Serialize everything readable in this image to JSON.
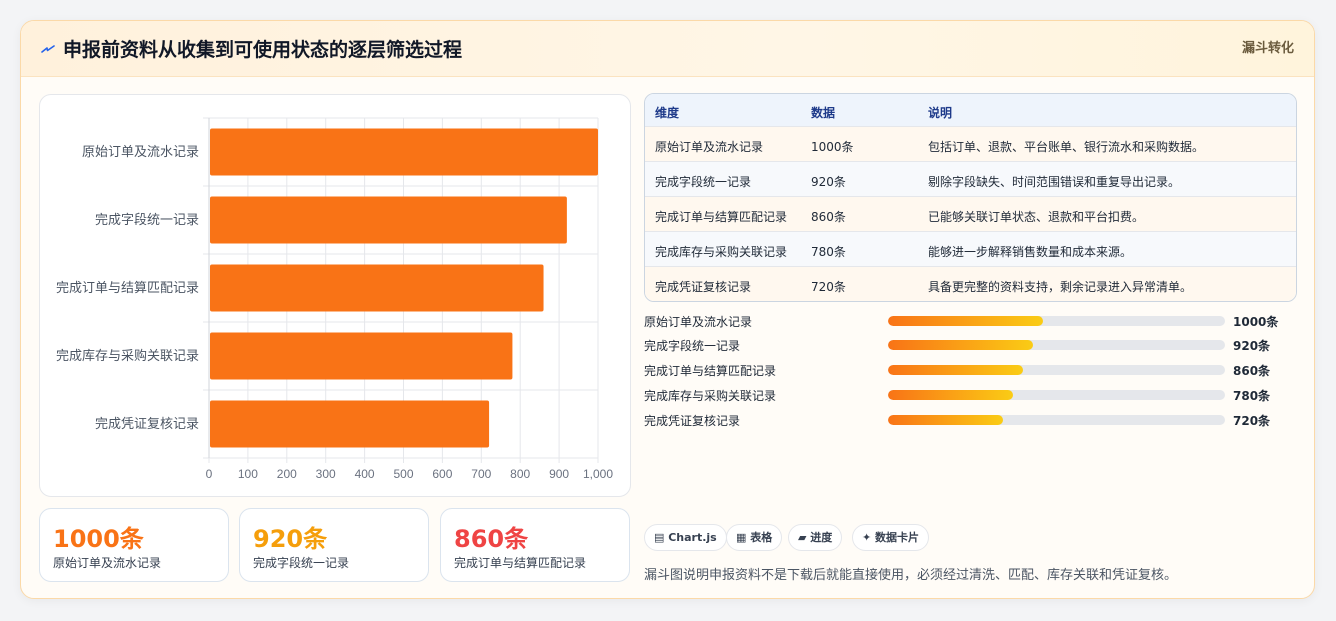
{
  "header": {
    "title": "申报前资料从收集到可使用状态的逐层筛选过程",
    "tag": "漏斗转化",
    "icon": "lightning-icon"
  },
  "chart_data": {
    "type": "bar",
    "orientation": "horizontal",
    "categories": [
      "原始订单及流水记录",
      "完成字段统一记录",
      "完成订单与结算匹配记录",
      "完成库存与采购关联记录",
      "完成凭证复核记录"
    ],
    "values": [
      1000,
      920,
      860,
      780,
      720
    ],
    "xlim": [
      0,
      1000
    ],
    "xticks": [
      "0",
      "100",
      "200",
      "300",
      "400",
      "500",
      "600",
      "700",
      "800",
      "900",
      "1,000"
    ],
    "grid": true,
    "bar_color": "#f97316"
  },
  "stats": [
    {
      "value": "1000条",
      "label": "原始订单及流水记录",
      "color": "#f97316"
    },
    {
      "value": "920条",
      "label": "完成字段统一记录",
      "color": "#f59e0b"
    },
    {
      "value": "860条",
      "label": "完成订单与结算匹配记录",
      "color": "#ef4444"
    }
  ],
  "table": {
    "headers": [
      "维度",
      "数据",
      "说明"
    ],
    "rows": [
      [
        "原始订单及流水记录",
        "1000条",
        "包括订单、退款、平台账单、银行流水和采购数据。"
      ],
      [
        "完成字段统一记录",
        "920条",
        "剔除字段缺失、时间范围错误和重复导出记录。"
      ],
      [
        "完成订单与结算匹配记录",
        "860条",
        "已能够关联订单状态、退款和平台扣费。"
      ],
      [
        "完成库存与采购关联记录",
        "780条",
        "能够进一步解释销售数量和成本来源。"
      ],
      [
        "完成凭证复核记录",
        "720条",
        "具备更完整的资料支持，剩余记录进入异常清单。"
      ]
    ]
  },
  "progress": [
    {
      "label": "原始订单及流水记录",
      "value": "1000条",
      "fraction": 0.46
    },
    {
      "label": "完成字段统一记录",
      "value": "920条",
      "fraction": 0.43
    },
    {
      "label": "完成订单与结算匹配记录",
      "value": "860条",
      "fraction": 0.4
    },
    {
      "label": "完成库存与采购关联记录",
      "value": "780条",
      "fraction": 0.37
    },
    {
      "label": "完成凭证复核记录",
      "value": "720条",
      "fraction": 0.34
    }
  ],
  "chips": [
    {
      "label": "▤ Chart.js"
    },
    {
      "label": "▦ 表格"
    },
    {
      "label": "▰ 进度"
    },
    {
      "label": "✦ 数据卡片"
    }
  ],
  "note": "漏斗图说明申报资料不是下载后就能直接使用，必须经过清洗、匹配、库存关联和凭证复核。"
}
